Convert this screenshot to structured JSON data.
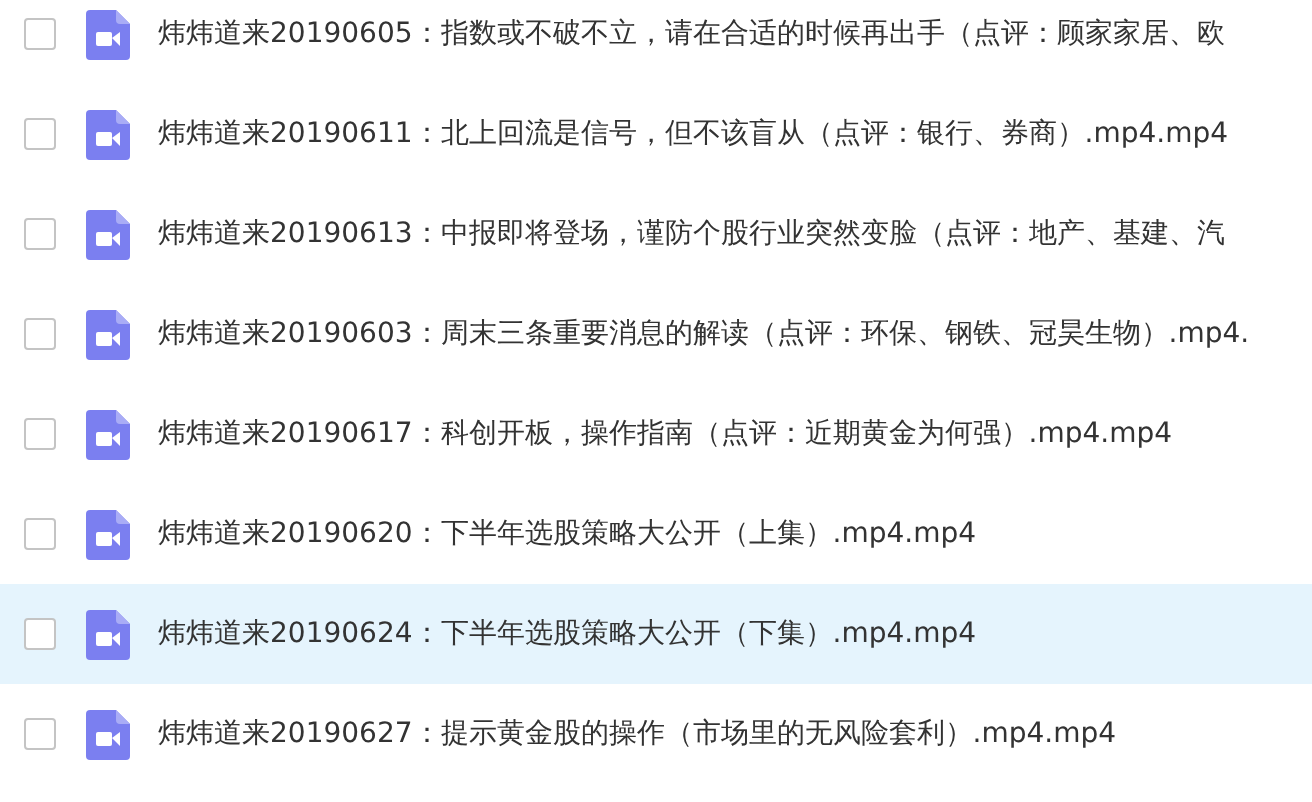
{
  "files": [
    {
      "name": "炜炜道来20190605：指数或不破不立，请在合适的时候再出手（点评：顾家家居、欧",
      "checked": false,
      "selected": false
    },
    {
      "name": "炜炜道来20190611：北上回流是信号，但不该盲从（点评：银行、券商）.mp4.mp4",
      "checked": false,
      "selected": false
    },
    {
      "name": "炜炜道来20190613：中报即将登场，谨防个股行业突然变脸（点评：地产、基建、汽",
      "checked": false,
      "selected": false
    },
    {
      "name": "炜炜道来20190603：周末三条重要消息的解读（点评：环保、钢铁、冠昊生物）.mp4.",
      "checked": false,
      "selected": false
    },
    {
      "name": "炜炜道来20190617：科创开板，操作指南（点评：近期黄金为何强）.mp4.mp4",
      "checked": false,
      "selected": false
    },
    {
      "name": "炜炜道来20190620：下半年选股策略大公开（上集）.mp4.mp4",
      "checked": false,
      "selected": false
    },
    {
      "name": "炜炜道来20190624：下半年选股策略大公开（下集）.mp4.mp4",
      "checked": false,
      "selected": true
    },
    {
      "name": "炜炜道来20190627：提示黄金股的操作（市场里的无风险套利）.mp4.mp4",
      "checked": false,
      "selected": false
    }
  ]
}
